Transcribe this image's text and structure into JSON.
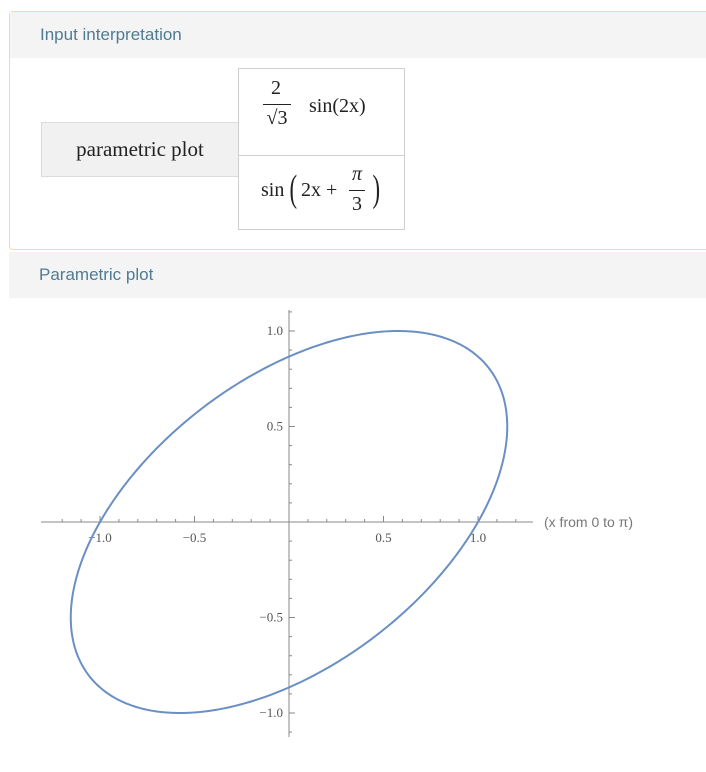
{
  "pod_input": {
    "title": "Input interpretation",
    "label": "parametric plot",
    "row1": {
      "coef_num": "2",
      "coef_den": "√3",
      "func": "sin(2x)"
    },
    "row2": {
      "func": "sin",
      "paren_open": "(",
      "inner": "2x +",
      "pi": "π",
      "three": "3",
      "paren_close": ")"
    }
  },
  "pod_plot": {
    "title": "Parametric plot"
  },
  "chart_data": {
    "type": "line",
    "title": "",
    "xlabel": "(x from 0 to π)",
    "ylabel": "",
    "xlim": [
      -1.22,
      1.22
    ],
    "ylim": [
      -1.12,
      1.1
    ],
    "x_ticks": [
      -1.0,
      -0.5,
      0.5,
      1.0
    ],
    "x_tick_labels": [
      "−1.0",
      "−0.5",
      "0.5",
      "1.0"
    ],
    "y_ticks": [
      -1.0,
      -0.5,
      0.5,
      1.0
    ],
    "y_tick_labels": [
      "−1.0",
      "−0.5",
      "0.5",
      "1.0"
    ],
    "series": [
      {
        "param": "x from 0 to π",
        "x_expr": "2/√3 sin(2x)",
        "y_expr": "sin(2x + π/3)",
        "color": "#6a8fc4",
        "points": [
          [
            0,
            0.866
          ],
          [
            0.289,
            0.999
          ],
          [
            0.5,
            0.999
          ],
          [
            0.866,
            0.866
          ],
          [
            1.0,
            0.5
          ],
          [
            1.0,
            0.0
          ],
          [
            1.155,
            0.0
          ],
          [
            0.866,
            -0.5
          ],
          [
            0.5,
            -0.793
          ],
          [
            0,
            -0.866
          ],
          [
            -0.5,
            -0.999
          ],
          [
            -0.866,
            -0.866
          ],
          [
            -1.155,
            -0.0
          ],
          [
            -1.0,
            0.0
          ],
          [
            -0.866,
            0.259
          ],
          [
            -0.5,
            0.707
          ],
          [
            0,
            0.866
          ]
        ]
      }
    ],
    "axis_color": "#555555",
    "grid": false
  }
}
